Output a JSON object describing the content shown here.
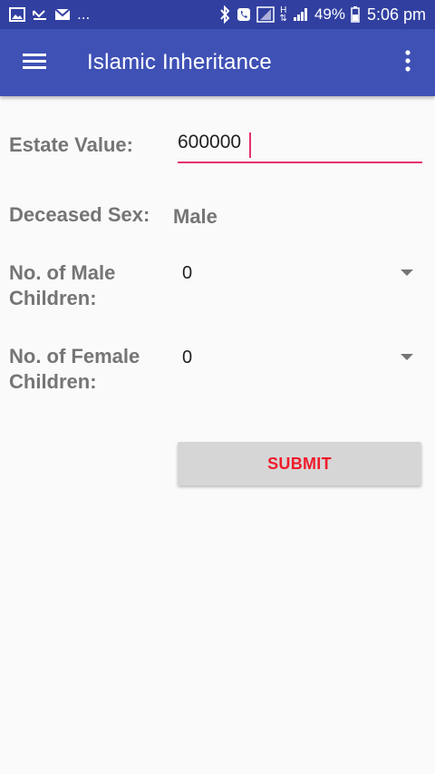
{
  "status_bar": {
    "notifications": [
      "gallery-icon",
      "missed-call-icon",
      "mail-icon"
    ],
    "more": "...",
    "network": "H",
    "battery": "49%",
    "time": "5:06 pm"
  },
  "app_bar": {
    "title": "Islamic Inheritance",
    "background": "#3f51b5"
  },
  "form": {
    "estate_label": "Estate Value:",
    "estate_value": "600000",
    "sex_label": "Deceased Sex:",
    "sex_value": "Male",
    "male_children_label": "No. of Male Children:",
    "male_children_line1": "No. of Male",
    "male_children_line2": "Children:",
    "male_children_value": "0",
    "female_children_label": "No. of Female Children:",
    "female_children_line1": "No. of Female",
    "female_children_line2": "Children:",
    "female_children_value": "0",
    "submit_label": "SUBMIT",
    "accent": "#e5316a",
    "submit_color": "#ef1b2a"
  }
}
